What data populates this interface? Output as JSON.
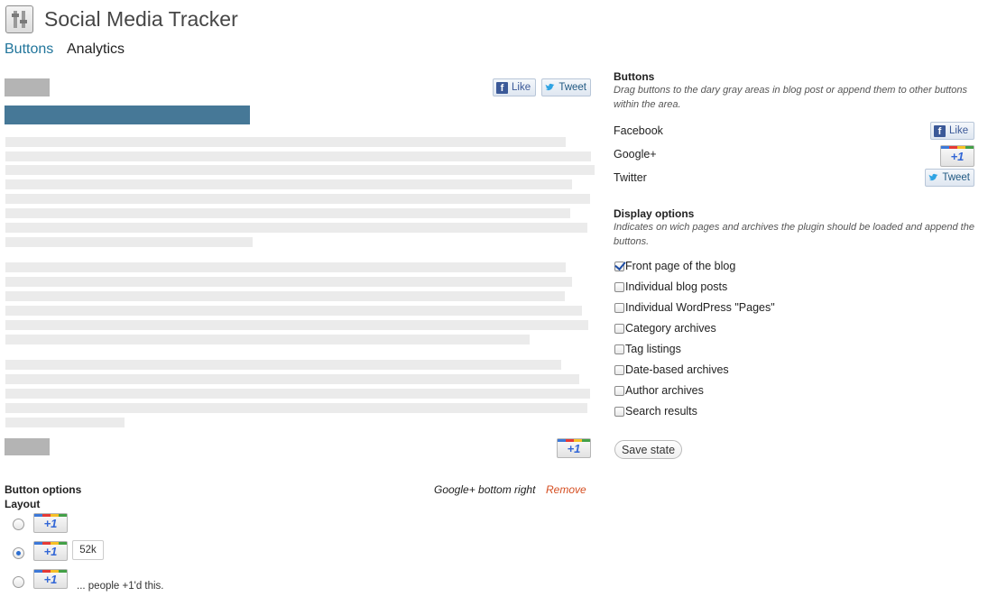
{
  "app": {
    "title": "Social Media Tracker"
  },
  "nav": {
    "tabs": [
      {
        "label": "Buttons"
      },
      {
        "label": "Analytics"
      }
    ]
  },
  "preview": {
    "facebook_like": "Like",
    "twitter_tweet": "Tweet",
    "gplus_label": "+1"
  },
  "panel": {
    "buttons_heading": "Buttons",
    "buttons_desc": "Drag buttons to the dary gray areas in blog post or append them to other buttons within the area.",
    "networks": [
      {
        "name": "Facebook",
        "button": "Like"
      },
      {
        "name": "Google+",
        "button": "+1"
      },
      {
        "name": "Twitter",
        "button": "Tweet"
      }
    ],
    "display_heading": "Display options",
    "display_desc": "Indicates on wich pages and archives the plugin should be loaded and append the buttons.",
    "options": [
      {
        "label": "Front page of the blog",
        "checked": true
      },
      {
        "label": "Individual blog posts",
        "checked": false
      },
      {
        "label": "Individual WordPress \"Pages\"",
        "checked": false
      },
      {
        "label": "Category archives",
        "checked": false
      },
      {
        "label": "Tag listings",
        "checked": false
      },
      {
        "label": "Date-based archives",
        "checked": false
      },
      {
        "label": "Author archives",
        "checked": false
      },
      {
        "label": "Search results",
        "checked": false
      }
    ],
    "save_label": "Save state"
  },
  "button_options": {
    "heading": "Button options",
    "layout_label": "Layout",
    "position_label": "Google+ bottom right",
    "remove_label": "Remove",
    "layouts": [
      {
        "button": "+1",
        "extra": "",
        "selected": false
      },
      {
        "button": "+1",
        "extra": "52k",
        "selected": true
      },
      {
        "button": "+1",
        "extra": "... people +1'd this.",
        "selected": false
      }
    ]
  },
  "colors": {
    "link_blue": "#21759b",
    "title_bar_blue": "#467897",
    "remove_red": "#d54e21"
  }
}
